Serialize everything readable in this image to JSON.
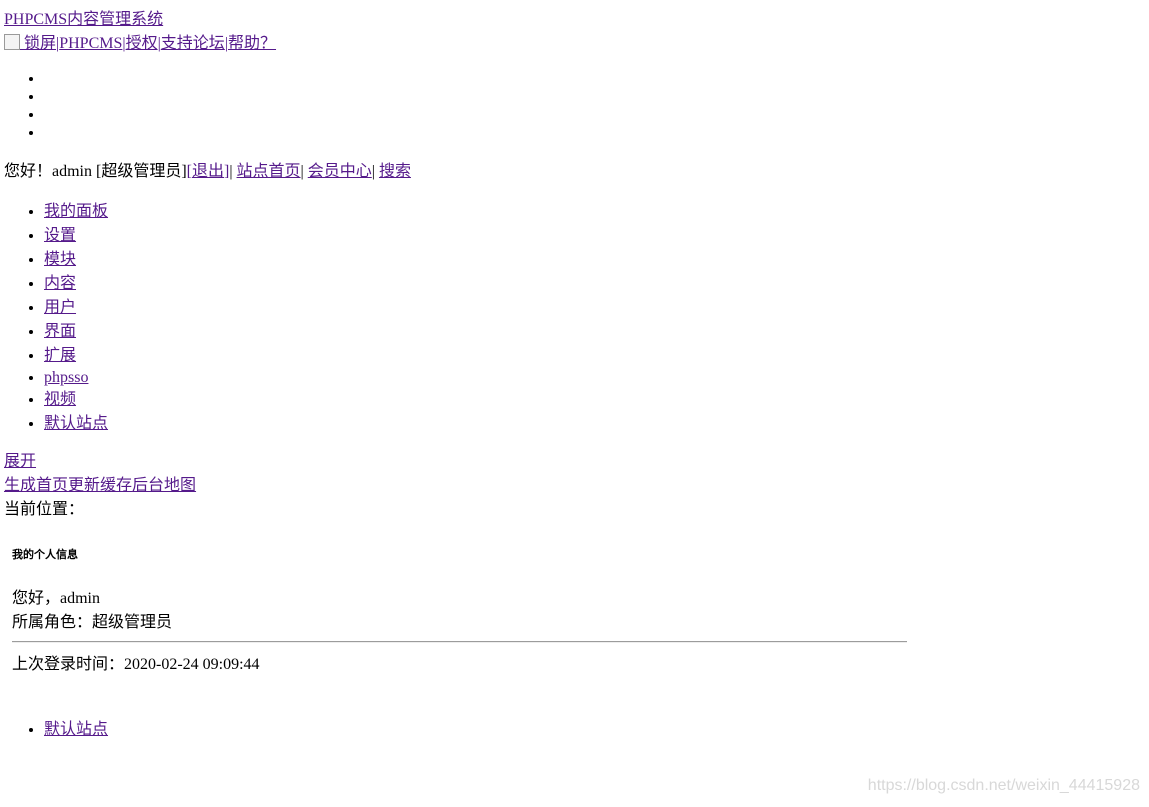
{
  "header": {
    "site_title": "PHPCMS内容管理系统",
    "toplinks": {
      "lock": " 锁屏",
      "sep1": "|",
      "phpcms": "PHPCMS",
      "sep2": "|",
      "license": "授权",
      "sep3": "|",
      "forum": "支持论坛",
      "sep4": "|",
      "help": "帮助？"
    }
  },
  "userbar": {
    "greeting": "您好！admin [超级管理员]",
    "bracket_open": "[",
    "logout": "退出",
    "bracket_close": "]",
    "sep1": "| ",
    "site_home": "站点首页",
    "sep2": "| ",
    "member_center": "会员中心",
    "sep3": "| ",
    "search": "搜索"
  },
  "main_menu": [
    {
      "label": "我的面板"
    },
    {
      "label": "设置"
    },
    {
      "label": "模块"
    },
    {
      "label": "内容"
    },
    {
      "label": "用户"
    },
    {
      "label": "界面"
    },
    {
      "label": "扩展"
    },
    {
      "label": "phpsso"
    },
    {
      "label": "视频"
    },
    {
      "label": "默认站点"
    }
  ],
  "toolbar": {
    "expand": "展开",
    "generate_home": "生成首页",
    "update_cache": "更新缓存",
    "admin_map": "后台地图"
  },
  "breadcrumb": {
    "label": "当前位置："
  },
  "profile": {
    "title": "我的个人信息",
    "hello": "您好，admin",
    "role": "所属角色：超级管理员",
    "last_login": "上次登录时间：2020-02-24 09:09:44"
  },
  "site_list": [
    {
      "label": "默认站点"
    }
  ],
  "watermark": "https://blog.csdn.net/weixin_44415928"
}
